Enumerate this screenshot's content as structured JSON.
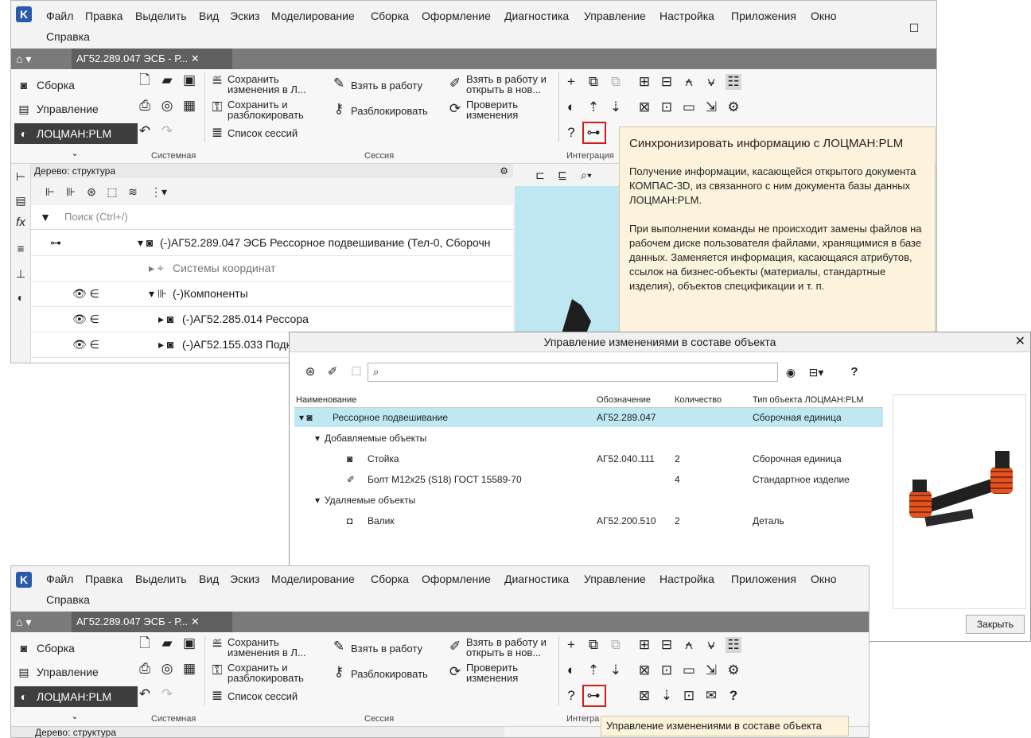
{
  "menu": [
    "Файл",
    "Правка",
    "Выделить",
    "Вид",
    "Эскиз",
    "Моделирование",
    "Сборка",
    "Оформление",
    "Диагностика",
    "Управление",
    "Настройка",
    "Приложения",
    "Окно",
    "Справка"
  ],
  "document_tab": "АГ52.289.047 ЭСБ - Р...",
  "nav": {
    "assembly": "Сборка",
    "management": "Управление",
    "lotsman": "ЛОЦМАН:PLM"
  },
  "ribbon": {
    "save_changes": "Сохранить\nизменения в Л...",
    "save_unlock": "Сохранить и\nразблокировать",
    "session_list": "Список сессий",
    "take_to_work": "Взять в работу",
    "unlock": "Разблокировать",
    "take_open_new": "Взять в работу и\nоткрыть в нов...",
    "check_changes": "Проверить\nизменения",
    "group_system": "Системная",
    "group_session": "Сессия",
    "group_integration": "Интеграция",
    "group_integration_short": "Интегра"
  },
  "tooltip": {
    "title": "Синхронизировать информацию с ЛОЦМАН:PLM",
    "p1": "Получение информации, касающейся открытого документа КОМПАС-3D, из связанного с ним документа базы данных ЛОЦМАН:PLM.",
    "p2": "При выполнении команды не происходит замены файлов на рабочем диске пользователя файлами, хранящимися в базе данных. Заменяется информация, касающаяся атрибутов, ссылок на бизнес-объекты (материалы, стандартные изделия), объектов спецификации и т. п."
  },
  "tree": {
    "panel_title": "Дерево: структура",
    "search_placeholder": "Поиск (Ctrl+/)",
    "rows": [
      "(-)АГ52.289.047 ЭСБ Рессорное подвешивание (Тел-0, Сборочн",
      "Системы координат",
      "(-)Компоненты",
      "(-)АГ52.285.014 Рессора",
      "(-)АГ52.155.033 Подк"
    ]
  },
  "dialog": {
    "title": "Управление изменениями в составе объекта",
    "columns": [
      "Наименование",
      "Обозначение",
      "Количество",
      "Тип объекта ЛОЦМАН:PLM"
    ],
    "rows": [
      {
        "name": "Рессорное подвешивание",
        "designation": "АГ52.289.047",
        "qty": "",
        "type": "Сборочная единица"
      },
      {
        "name": "Добавляемые объекты",
        "designation": "",
        "qty": "",
        "type": ""
      },
      {
        "name": "Стойка",
        "designation": "АГ52.040.111",
        "qty": "2",
        "type": "Сборочная единица"
      },
      {
        "name": "Болт М12х25 (S18) ГОСТ 15589-70",
        "designation": "",
        "qty": "4",
        "type": "Стандартное изделие"
      },
      {
        "name": "Удаляемые объекты",
        "designation": "",
        "qty": "",
        "type": ""
      },
      {
        "name": "Валик",
        "designation": "АГ52.200.510",
        "qty": "2",
        "type": "Деталь"
      }
    ],
    "close_label": "Закрыть"
  },
  "tooltip2": "Управление изменениями в составе объекта",
  "colors": {
    "accent_red": "#d21b1b",
    "selected_row": "#bfe8f2",
    "tooltip_bg": "#fdf3dc",
    "viewport_bg": "#bfe7f2"
  }
}
